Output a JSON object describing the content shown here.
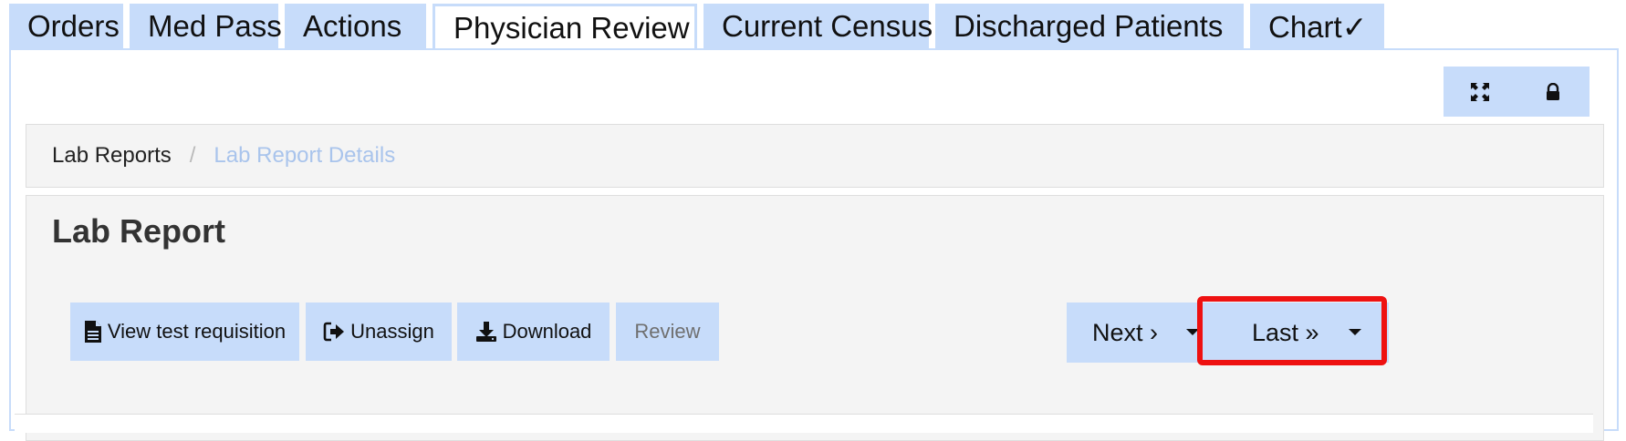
{
  "tabs": [
    {
      "label": "Orders"
    },
    {
      "label": "Med Pass"
    },
    {
      "label": "Actions"
    },
    {
      "label": "Physician Review"
    },
    {
      "label": "Current Census"
    },
    {
      "label": "Discharged Patients"
    },
    {
      "label": "Chart✓"
    }
  ],
  "active_tab": "Physician Review",
  "breadcrumb": {
    "items": [
      {
        "label": "Lab Reports"
      },
      {
        "label": "Lab Report Details"
      }
    ],
    "separator": "/"
  },
  "card": {
    "title": "Lab Report"
  },
  "actions": {
    "view_test_requisition": "View test requisition",
    "unassign": "Unassign",
    "download": "Download",
    "review": "Review"
  },
  "pager": {
    "next": "Next ›",
    "last": "Last »"
  },
  "colors": {
    "accent": "#c7dcfa",
    "highlight": "#ee1111",
    "panel_bg": "#f4f4f4"
  }
}
